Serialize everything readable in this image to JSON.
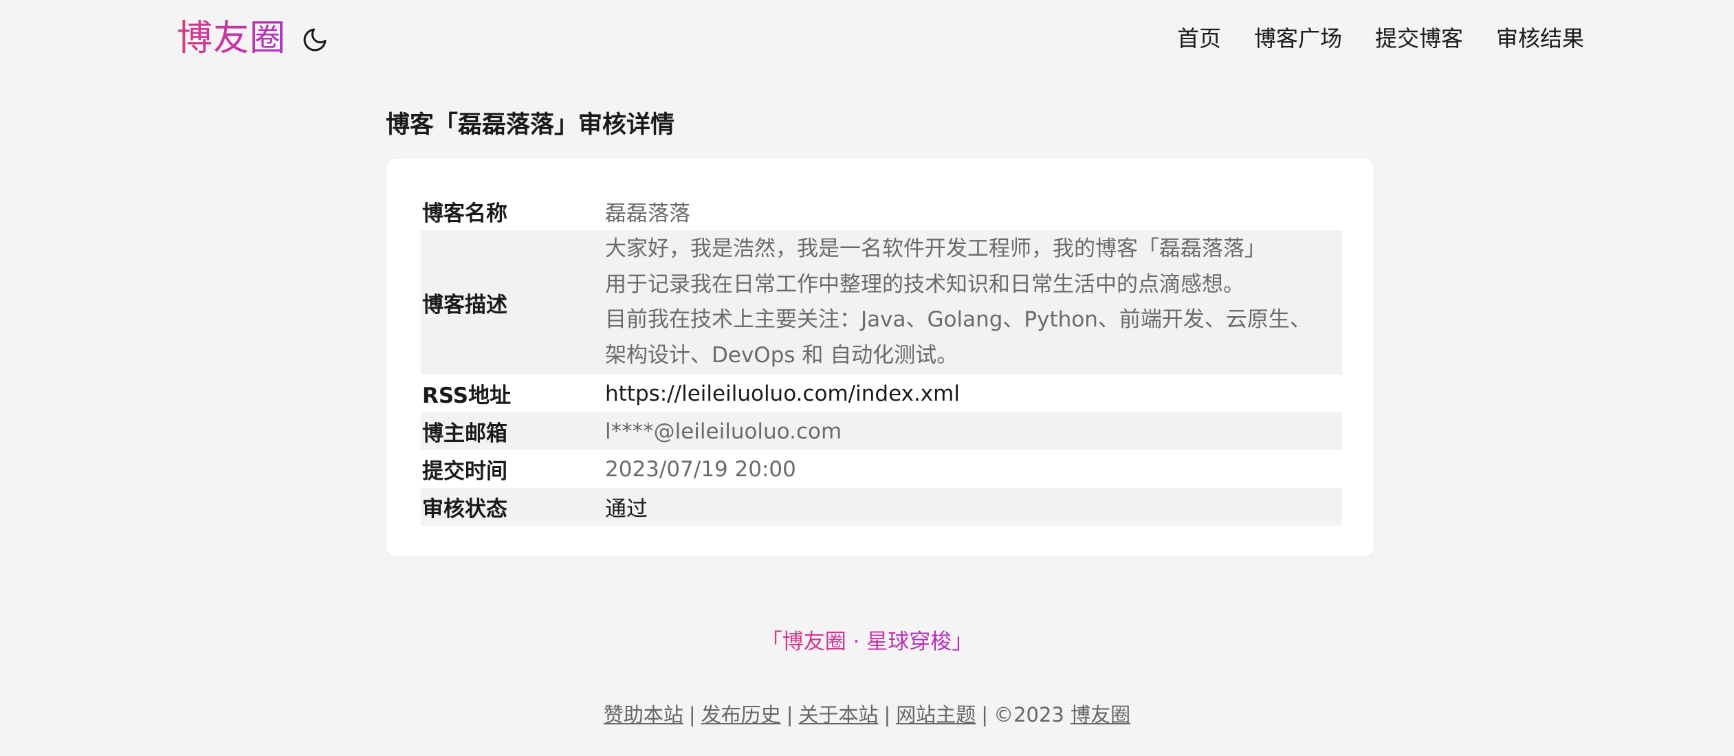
{
  "header": {
    "logo_text": "博友圈",
    "theme_toggle_icon": "moon-icon",
    "nav": [
      {
        "label": "首页"
      },
      {
        "label": "博客广场"
      },
      {
        "label": "提交博客"
      },
      {
        "label": "审核结果"
      }
    ]
  },
  "page": {
    "title": "博客「磊磊落落」审核详情"
  },
  "details": {
    "name_label": "博客名称",
    "name_value": "磊磊落落",
    "desc_label": "博客描述",
    "desc_lines": [
      "大家好，我是浩然，我是一名软件开发工程师，我的博客「磊磊落落」",
      "用于记录我在日常工作中整理的技术知识和日常生活中的点滴感想。",
      "目前我在技术上主要关注：Java、Golang、Python、前端开发、云原生、",
      "架构设计、DevOps 和 自动化测试。"
    ],
    "rss_label": "RSS地址",
    "rss_value": "https://leileiluoluo.com/index.xml",
    "email_label": "博主邮箱",
    "email_value": "l****@leileiluoluo.com",
    "time_label": "提交时间",
    "time_value": "2023/07/19 20:00",
    "status_label": "审核状态",
    "status_value": "通过"
  },
  "footer": {
    "slogan": "「博友圈 · 星球穿梭」",
    "links": [
      {
        "label": "赞助本站"
      },
      {
        "label": "发布历史"
      },
      {
        "label": "关于本站"
      },
      {
        "label": "网站主题"
      }
    ],
    "separator": "|",
    "copyright_prefix": "©2023",
    "copyright_link": "博友圈"
  },
  "colors": {
    "brand_gradient_start": "#d93a82",
    "brand_gradient_end": "#b12fc8",
    "background": "#f4f4f4",
    "card": "#ffffff",
    "stripe": "#f2f2f2"
  }
}
